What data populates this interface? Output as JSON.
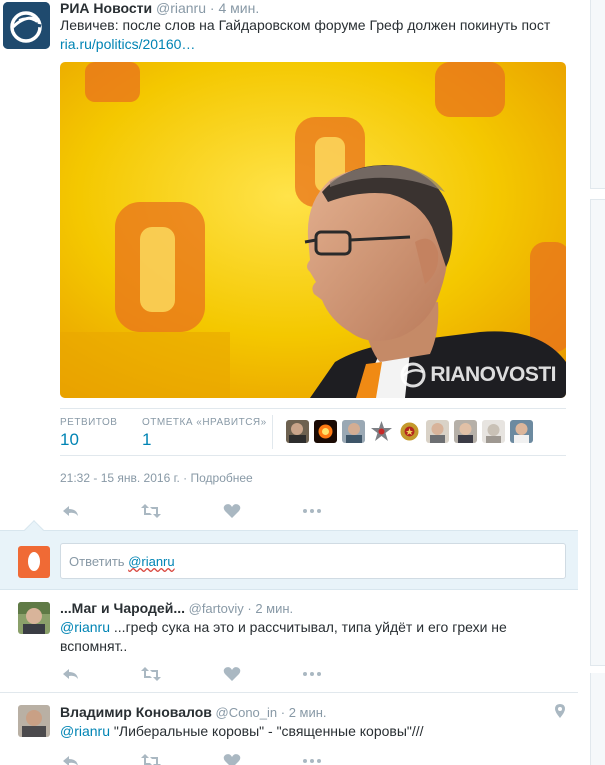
{
  "tweet": {
    "author": "РИА Новости",
    "handle": "@rianru",
    "time": "4 мин.",
    "text": "Левичев: после слов на Гайдаровском форуме Греф должен покинуть пост",
    "link": "ria.ru/politics/20160…",
    "photo": {
      "watermark": "RIANOVOSTI"
    },
    "stats": {
      "retweets_label": "РЕТВИТОВ",
      "retweets": "10",
      "likes_label": "ОТМЕТКА «НРАВИТСЯ»",
      "likes": "1",
      "likers": [
        "liker-avatar-1",
        "liker-avatar-2",
        "liker-avatar-3",
        "liker-avatar-4",
        "liker-avatar-5",
        "liker-avatar-6",
        "liker-avatar-7",
        "liker-avatar-8",
        "liker-avatar-9"
      ]
    },
    "datetime": "21:32 - 15 янв. 2016 г.",
    "separator": " · ",
    "details_link": "Подробнее",
    "actions": [
      "reply-icon",
      "retweet-icon",
      "like-icon",
      "more-icon"
    ]
  },
  "reply_box": {
    "prefix": "Ответить ",
    "handle": "@rianru"
  },
  "replies": [
    {
      "author": "...Маг и Чародей...",
      "handle": "@fartoviy",
      "time": "2 мин.",
      "mention": "@rianru",
      "text": " ...греф сука на это и рассчитывал, типа уйдёт и его грехи не вспомнят.."
    },
    {
      "author": "Владимир Коновалов",
      "handle": "@Cono_in",
      "time": "2 мин.",
      "mention": "@rianru",
      "text": " \"Либеральные коровы\" - \"священные коровы\"///"
    }
  ],
  "colors": {
    "link": "#0084b4",
    "muted": "#8899a6",
    "reply_bg": "#e8f3f9",
    "photo_bg": "#f2c400"
  }
}
